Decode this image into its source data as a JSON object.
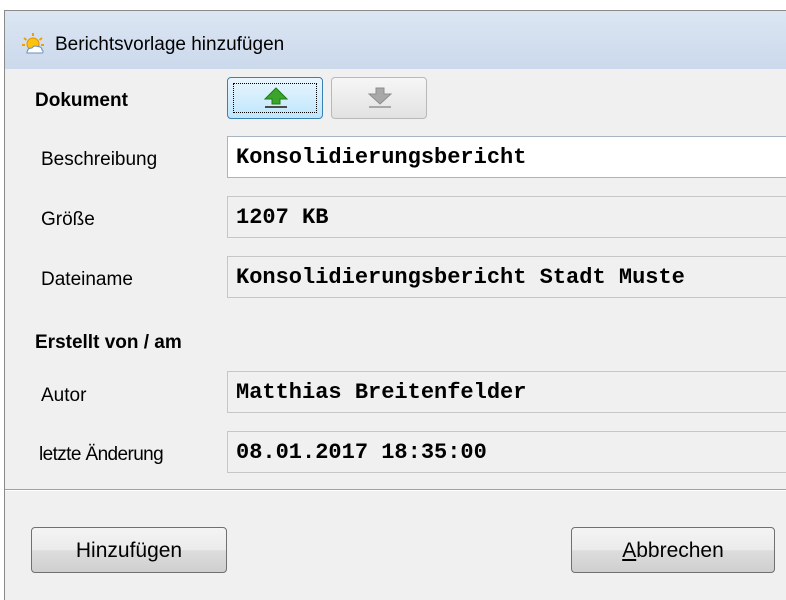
{
  "window": {
    "title": "Berichtsvorlage hinzufügen"
  },
  "icons": {
    "app": "weather-sun-icon",
    "upload": "upload-arrow-icon",
    "download": "download-arrow-icon"
  },
  "document": {
    "section_label": "Dokument",
    "fields": {
      "description": {
        "label": "Beschreibung",
        "value": "Konsolidierungsbericht"
      },
      "size": {
        "label": "Größe",
        "value": "1207 KB"
      },
      "filename": {
        "label": "Dateiname",
        "value": "Konsolidierungsbericht Stadt Muste"
      }
    }
  },
  "created": {
    "section_label": "Erstellt von / am",
    "fields": {
      "author": {
        "label": "Autor",
        "value": "Matthias Breitenfelder"
      },
      "modified": {
        "label": "letzte Änderung",
        "value": "08.01.2017 18:35:00"
      }
    }
  },
  "buttons": {
    "add": "Hinzufügen",
    "cancel_mnemonic": "A",
    "cancel_rest": "bbrechen"
  },
  "colors": {
    "upload_arrow": "#3aa52a",
    "download_arrow": "#a8a8a8",
    "titlebar": "#cbd9ec"
  }
}
